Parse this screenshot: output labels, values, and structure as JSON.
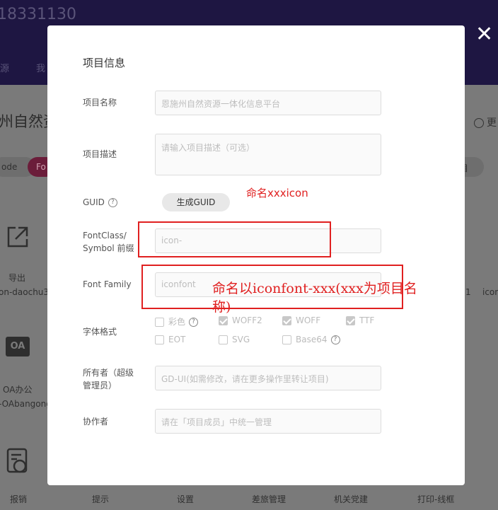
{
  "background": {
    "title": "18331130",
    "nav": [
      "源",
      "我"
    ],
    "project_heading": "州自然资",
    "radio_more": "更",
    "pill_left": "ode",
    "pill_mid": "Fo",
    "pill_right": "目",
    "icons": [
      {
        "label": "导出",
        "sub": "on-daochu3",
        "icon": "export-icon"
      },
      {
        "label": "OA办公",
        "sub": "-OAbangong",
        "icon": "oa-icon"
      },
      {
        "label": "报销",
        "sub": "",
        "icon": "reimburse-icon"
      }
    ],
    "bottom_labels": [
      "报销",
      "提示",
      "设置",
      "差旅管理",
      "机关党建",
      "打印-线框"
    ],
    "right_labels": [
      "1",
      "icon"
    ]
  },
  "modal": {
    "title": "项目信息",
    "close_symbol": "✕",
    "fields": {
      "name": {
        "label": "项目名称",
        "placeholder": "恩施州自然资源一体化信息平台"
      },
      "desc": {
        "label": "项目描述",
        "placeholder": "请输入项目描述（可选）"
      },
      "guid": {
        "label": "GUID",
        "help": "?",
        "button": "生成GUID"
      },
      "fontclass": {
        "label_line1": "FontClass/",
        "label_line2": "Symbol 前缀",
        "placeholder": "icon-"
      },
      "fontfamily": {
        "label": "Font Family",
        "placeholder": "iconfont"
      },
      "format": {
        "label": "字体格式",
        "options": [
          {
            "label": "彩色",
            "checked": false,
            "help": "?"
          },
          {
            "label": "WOFF2",
            "checked": true
          },
          {
            "label": "WOFF",
            "checked": true
          },
          {
            "label": "TTF",
            "checked": true
          },
          {
            "label": "EOT",
            "checked": false
          },
          {
            "label": "SVG",
            "checked": false
          },
          {
            "label": "Base64",
            "checked": false,
            "help": "?"
          }
        ]
      },
      "owner": {
        "label_line1": "所有者（超级",
        "label_line2": "管理员）",
        "placeholder": "GD-UI(如需修改，请在更多操作里转让项目)"
      },
      "collab": {
        "label": "协作者",
        "placeholder": "请在「项目成员」中统一管理"
      }
    }
  },
  "annotations": {
    "guid_note": "命名xxxicon",
    "family_note_line1": "命名以iconfont-xxx(xxx为项目名",
    "family_note_line2": "称)"
  },
  "colors": {
    "header_bg": "#1e1642",
    "overlay_bg": "#7a7a7a",
    "annotation": "#e02020"
  }
}
